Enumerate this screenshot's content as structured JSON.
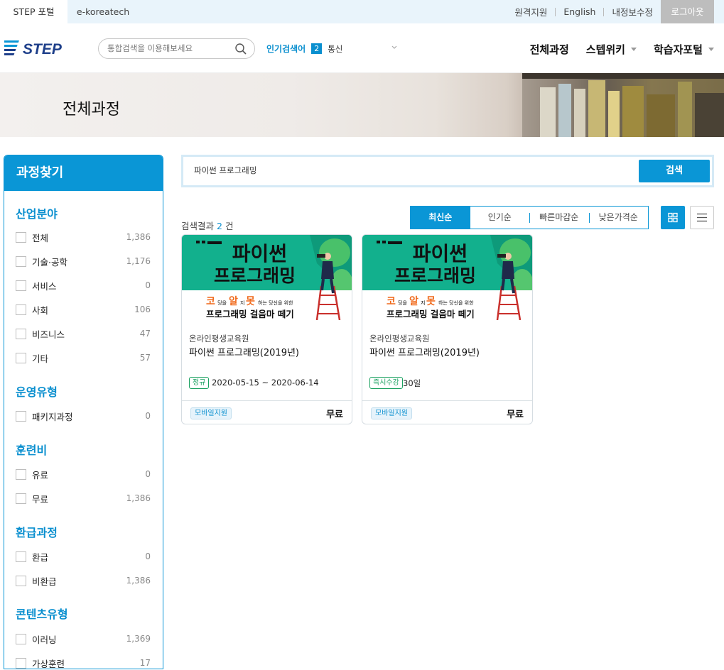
{
  "topbar": {
    "tabs": [
      "STEP 포털",
      "e-koreatech"
    ],
    "links": [
      "원격지원",
      "English",
      "내정보수정"
    ],
    "logout": "로그아웃"
  },
  "header": {
    "logo_text": "STEP",
    "search_placeholder": "통합검색을 이용해보세요",
    "popular_label": "인기검색어",
    "popular_rank": "2",
    "popular_word": "통신",
    "nav": [
      "전체과정",
      "스텝위키",
      "학습자포털"
    ]
  },
  "banner": {
    "title": "전체과정"
  },
  "sidebar": {
    "title": "과정찾기",
    "groups": [
      {
        "title": "산업분야",
        "options": [
          {
            "label": "전체",
            "count": "1,386"
          },
          {
            "label": "기술·공학",
            "count": "1,176"
          },
          {
            "label": "서비스",
            "count": "0"
          },
          {
            "label": "사회",
            "count": "106"
          },
          {
            "label": "비즈니스",
            "count": "47"
          },
          {
            "label": "기타",
            "count": "57"
          }
        ]
      },
      {
        "title": "운영유형",
        "options": [
          {
            "label": "패키지과정",
            "count": "0"
          }
        ]
      },
      {
        "title": "훈련비",
        "options": [
          {
            "label": "유료",
            "count": "0"
          },
          {
            "label": "무료",
            "count": "1,386"
          }
        ]
      },
      {
        "title": "환급과정",
        "options": [
          {
            "label": "환급",
            "count": "0"
          },
          {
            "label": "비환급",
            "count": "1,386"
          }
        ]
      },
      {
        "title": "콘텐츠유형",
        "options": [
          {
            "label": "이러닝",
            "count": "1,369"
          },
          {
            "label": "가상훈련",
            "count": "17"
          }
        ]
      }
    ]
  },
  "search": {
    "value": "파이썬 프로그래밍",
    "button": "검색"
  },
  "result": {
    "prefix": "검색결과",
    "count": "2",
    "suffix": "건"
  },
  "sort": [
    "최신순",
    "인기순",
    "빠른마감순",
    "낮은가격순"
  ],
  "thumb": {
    "line1": "파이썬",
    "line2": "프로그래밍",
    "sub_a": "코",
    "sub_a2": "딩을",
    "sub_b": "알",
    "sub_b2": "지",
    "sub_c": "못",
    "sub_c2": "하는 당신을 위한",
    "sub2": "프로그래밍 걸음마 떼기"
  },
  "cards": [
    {
      "org": "온라인평생교육원",
      "title": "파이썬 프로그래밍(2019년)",
      "tag": "정규",
      "period": "2020-05-15 ~ 2020-06-14",
      "mobile": "모바일지원",
      "price": "무료"
    },
    {
      "org": "온라인평생교육원",
      "title": "파이썬 프로그래밍(2019년)",
      "tag": "즉시수강",
      "period": "30일",
      "mobile": "모바일지원",
      "price": "무료"
    }
  ],
  "colors": {
    "accent": "#0a96d6",
    "thumb_bg": "#0fae8c",
    "tag_green": "#1aa160"
  }
}
